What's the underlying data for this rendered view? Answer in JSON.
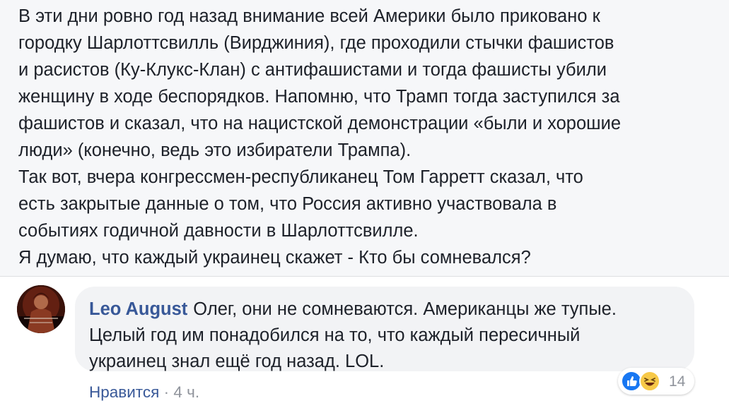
{
  "post": {
    "lines": [
      "В эти дни ровно год назад внимание всей Америки было приковано к",
      "городку Шарлоттсвилль (Вирджиния), где проходили стычки фашистов",
      "и расистов (Ку-Клукс-Клан) с антифашистами и тогда фашисты убили",
      "женщину в ходе беспорядков. Напомню, что Трамп тогда заступился за",
      "фашистов и сказал, что на нацистской демонстрации «были и хорошие",
      "люди» (конечно, ведь это избиратели Трампа).",
      "Так вот, вчера конгрессмен-республиканец Том Гарретт сказал, что",
      "есть закрытые данные о том, что Россия активно участвовала в",
      "событиях годичной давности в Шарлоттсвилле.",
      "Я думаю, что каждый украинец скажет - Кто бы сомневался?"
    ]
  },
  "comment": {
    "author": "Leo August",
    "lines": [
      "Олег, они не сомневаются. Американцы же тупые.",
      "Целый год им понадобился на то, что каждый пересичный",
      "украинец знал ещё год назад. LOL."
    ],
    "reactions": {
      "icons": [
        "like-reaction-icon",
        "haha-reaction-icon"
      ],
      "count": "14"
    },
    "actions": {
      "like": "Нравится",
      "separator": "·",
      "time": "4 ч."
    }
  },
  "colors": {
    "link": "#385898",
    "text": "#1d2129",
    "muted": "#90949c",
    "post_bg": "#f6f7f9",
    "bubble_bg": "#f2f3f5"
  }
}
